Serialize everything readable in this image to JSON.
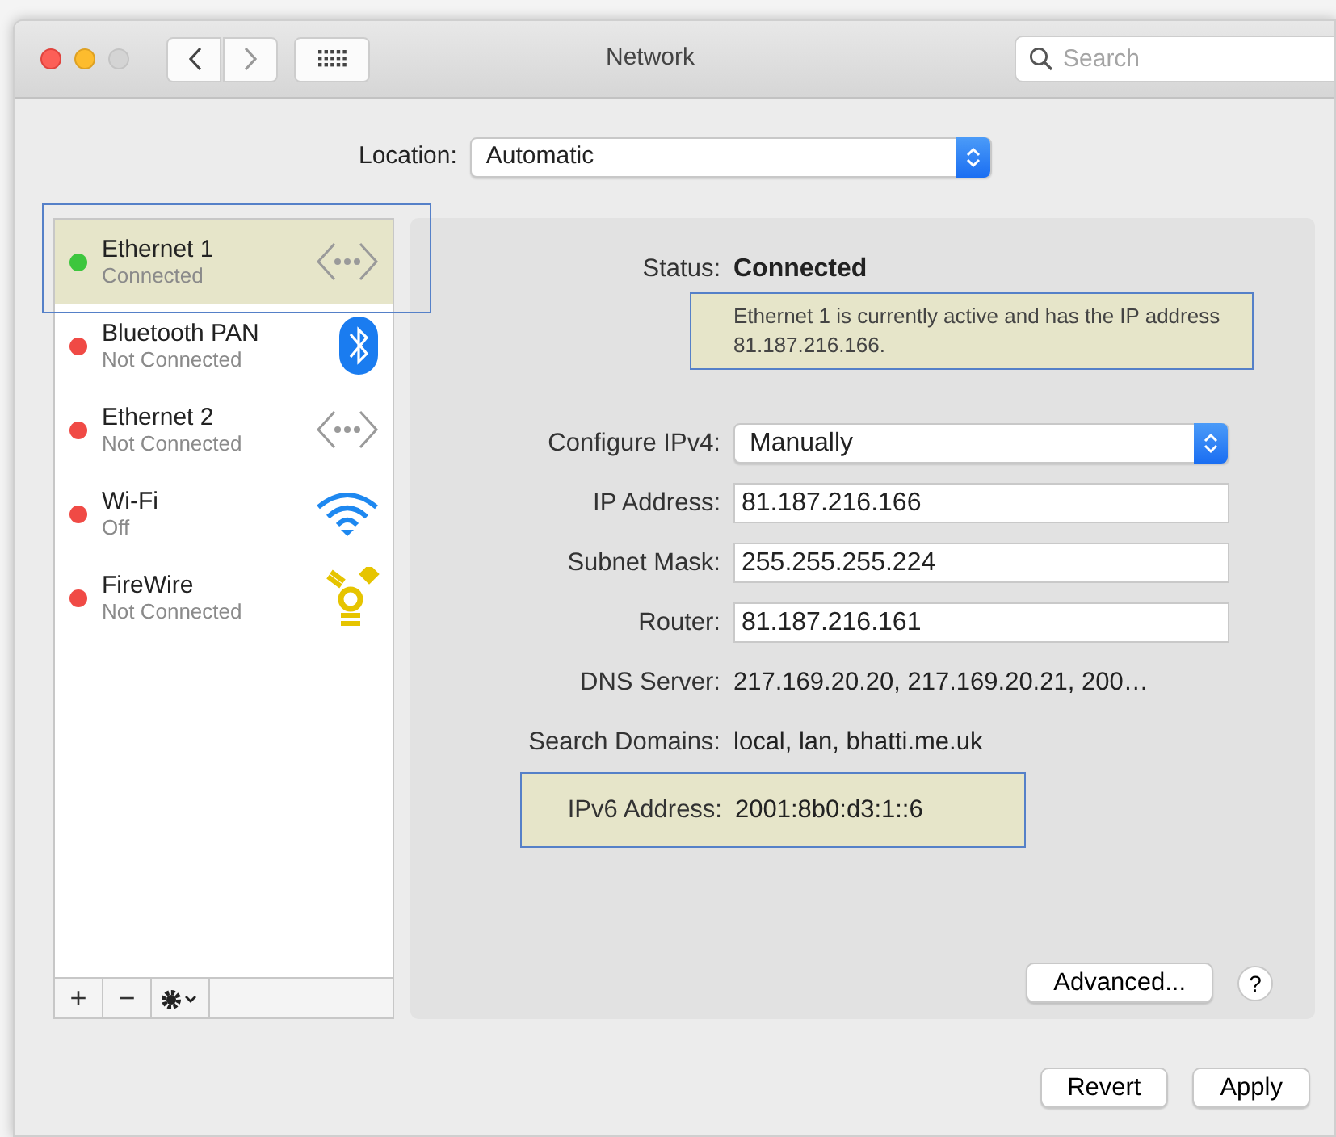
{
  "window": {
    "title": "Network",
    "search": {
      "placeholder": "Search"
    }
  },
  "location": {
    "label": "Location:",
    "value": "Automatic"
  },
  "services": [
    {
      "name": "Ethernet 1",
      "status": "Connected",
      "color": "#3dc63d",
      "selected": true,
      "kind": "ethernet"
    },
    {
      "name": "Bluetooth PAN",
      "status": "Not Connected",
      "color": "#f04a45",
      "selected": false,
      "kind": "bluetooth"
    },
    {
      "name": "Ethernet 2",
      "status": "Not Connected",
      "color": "#f04a45",
      "selected": false,
      "kind": "ethernet"
    },
    {
      "name": "Wi-Fi",
      "status": "Off",
      "color": "#f04a45",
      "selected": false,
      "kind": "wifi"
    },
    {
      "name": "FireWire",
      "status": "Not Connected",
      "color": "#f04a45",
      "selected": false,
      "kind": "firewire"
    }
  ],
  "list_toolbar": [
    "+",
    "−"
  ],
  "status": {
    "label": "Status:",
    "value": "Connected",
    "message": "Ethernet 1 is currently active and has the IP address 81.187.216.166.",
    "highlighted": true
  },
  "fields": [
    {
      "label": "Configure IPv4:",
      "value": "Manually",
      "kind": "select",
      "highlighted": false
    },
    {
      "label": "IP Address:",
      "value": "81.187.216.166",
      "kind": "input",
      "highlighted": false
    },
    {
      "label": "Subnet Mask:",
      "value": "255.255.255.224",
      "kind": "input",
      "highlighted": false
    },
    {
      "label": "Router:",
      "value": "81.187.216.161",
      "kind": "input",
      "highlighted": false
    },
    {
      "label": "DNS Server:",
      "value": "217.169.20.20, 217.169.20.21, 200…",
      "kind": "text",
      "highlighted": false
    },
    {
      "label": "Search Domains:",
      "value": "local, lan, bhatti.me.uk",
      "kind": "text",
      "highlighted": false
    },
    {
      "label": "IPv6 Address:",
      "value": "2001:8b0:d3:1::6",
      "kind": "text",
      "highlighted": true
    }
  ],
  "advanced": "Advanced...",
  "help": "?",
  "buttons": [
    "Revert",
    "Apply"
  ]
}
